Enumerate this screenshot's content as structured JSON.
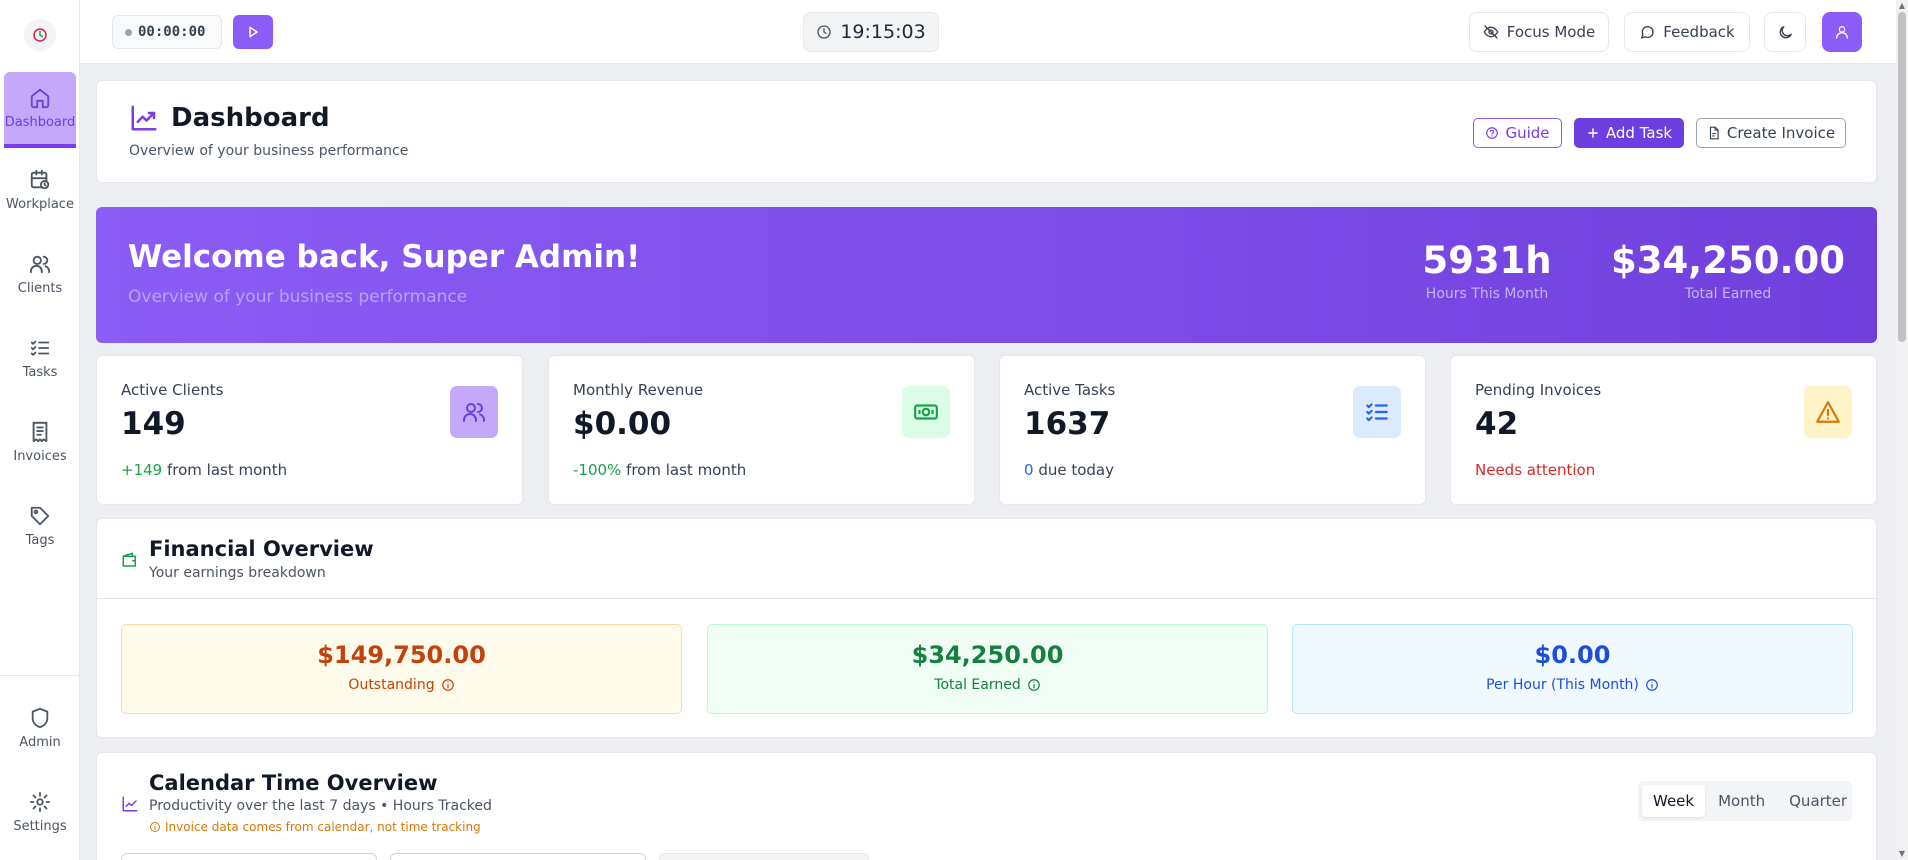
{
  "sidebar": {
    "items": [
      {
        "label": "Dashboard",
        "icon": "home-icon",
        "active": true
      },
      {
        "label": "Workplace",
        "icon": "calendar-clock-icon"
      },
      {
        "label": "Clients",
        "icon": "users-icon"
      },
      {
        "label": "Tasks",
        "icon": "list-checks-icon"
      },
      {
        "label": "Invoices",
        "icon": "receipt-icon"
      },
      {
        "label": "Tags",
        "icon": "tag-icon"
      }
    ],
    "bottom_items": [
      {
        "label": "Admin",
        "icon": "shield-icon"
      },
      {
        "label": "Settings",
        "icon": "gear-icon"
      }
    ]
  },
  "topbar": {
    "timer": "00:00:00",
    "clock": "19:15:03",
    "focus_mode": "Focus Mode",
    "feedback": "Feedback"
  },
  "page_header": {
    "title": "Dashboard",
    "subtitle": "Overview of your business performance",
    "guide": "Guide",
    "add_task": "Add Task",
    "create_invoice": "Create Invoice"
  },
  "welcome": {
    "title": "Welcome back, Super Admin!",
    "subtitle": "Overview of your business performance",
    "hours_value": "5931h",
    "hours_label": "Hours This Month",
    "earned_value": "$34,250.00",
    "earned_label": "Total Earned"
  },
  "stats": [
    {
      "label": "Active Clients",
      "value": "149",
      "delta": "+149",
      "foot": " from last month",
      "delta_color": "#16a34a",
      "icon": "users-icon",
      "icon_bg": "#c4a9fb",
      "icon_color": "#6d3fe0"
    },
    {
      "label": "Monthly Revenue",
      "value": "$0.00",
      "delta": "-100%",
      "foot": " from last month",
      "delta_color": "#16a34a",
      "icon": "banknote-icon",
      "icon_bg": "#dcfce7",
      "icon_color": "#16a34a"
    },
    {
      "label": "Active Tasks",
      "value": "1637",
      "delta": "0",
      "foot": " due today",
      "delta_color": "#2563eb",
      "icon": "list-checks-icon",
      "icon_bg": "#dbeafe",
      "icon_color": "#2563eb"
    },
    {
      "label": "Pending Invoices",
      "value": "42",
      "delta": "Needs attention",
      "foot": "",
      "delta_color": "#dc2626",
      "icon": "warning-icon",
      "icon_bg": "#fef3c7",
      "icon_color": "#d97706"
    }
  ],
  "financial": {
    "title": "Financial Overview",
    "subtitle": "Your earnings breakdown",
    "boxes": [
      {
        "value": "$149,750.00",
        "label": "Outstanding",
        "color": "#c2410c",
        "bg": "#fffbeb",
        "border": "#fcd9a8"
      },
      {
        "value": "$34,250.00",
        "label": "Total Earned",
        "color": "#15803d",
        "bg": "#f0fdf4",
        "border": "#bbf7d0"
      },
      {
        "value": "$0.00",
        "label": "Per Hour (This Month)",
        "color": "#1d4ed8",
        "bg": "#f0f9ff",
        "border": "#bae6fd"
      }
    ]
  },
  "calendar": {
    "title": "Calendar Time Overview",
    "subtitle": "Productivity over the last 7 days • Hours Tracked",
    "note": "Invoice data comes from calendar, not time tracking",
    "periods": [
      "Week",
      "Month",
      "Quarter"
    ],
    "active_period": "Week"
  }
}
